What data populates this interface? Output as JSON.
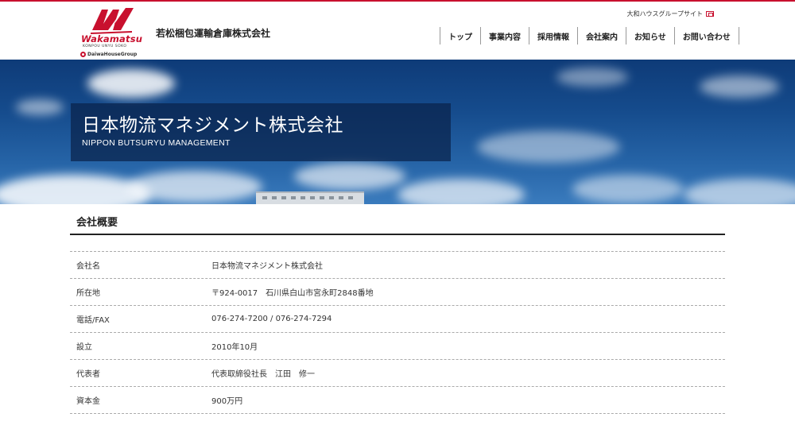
{
  "header": {
    "logo": {
      "wordmark": "Wakamatsu",
      "subtext": "KONPOU UNYU SOKO",
      "group": "DaiwaHouseGroup",
      "brand_color": "#c8102e"
    },
    "company_name": "若松梱包運輸倉庫株式会社",
    "daiwa_link": "大和ハウスグループサイト",
    "nav": [
      {
        "label": "トップ"
      },
      {
        "label": "事業内容"
      },
      {
        "label": "採用情報"
      },
      {
        "label": "会社案内"
      },
      {
        "label": "お知らせ"
      },
      {
        "label": "お問い合わせ"
      }
    ]
  },
  "hero": {
    "title": "日本物流マネジメント株式会社",
    "subtitle": "NIPPON BUTSURYU MANAGEMENT"
  },
  "section": {
    "title": "会社概要"
  },
  "info": [
    {
      "label": "会社名",
      "value": "日本物流マネジメント株式会社"
    },
    {
      "label": "所在地",
      "value": "〒924-0017　石川県白山市宮永町2848番地"
    },
    {
      "label": "電話/FAX",
      "value": "076-274-7200 / 076-274-7294"
    },
    {
      "label": "設立",
      "value": "2010年10月"
    },
    {
      "label": "代表者",
      "value": "代表取締役社長　江田　修一"
    },
    {
      "label": "資本金",
      "value": "900万円"
    }
  ]
}
